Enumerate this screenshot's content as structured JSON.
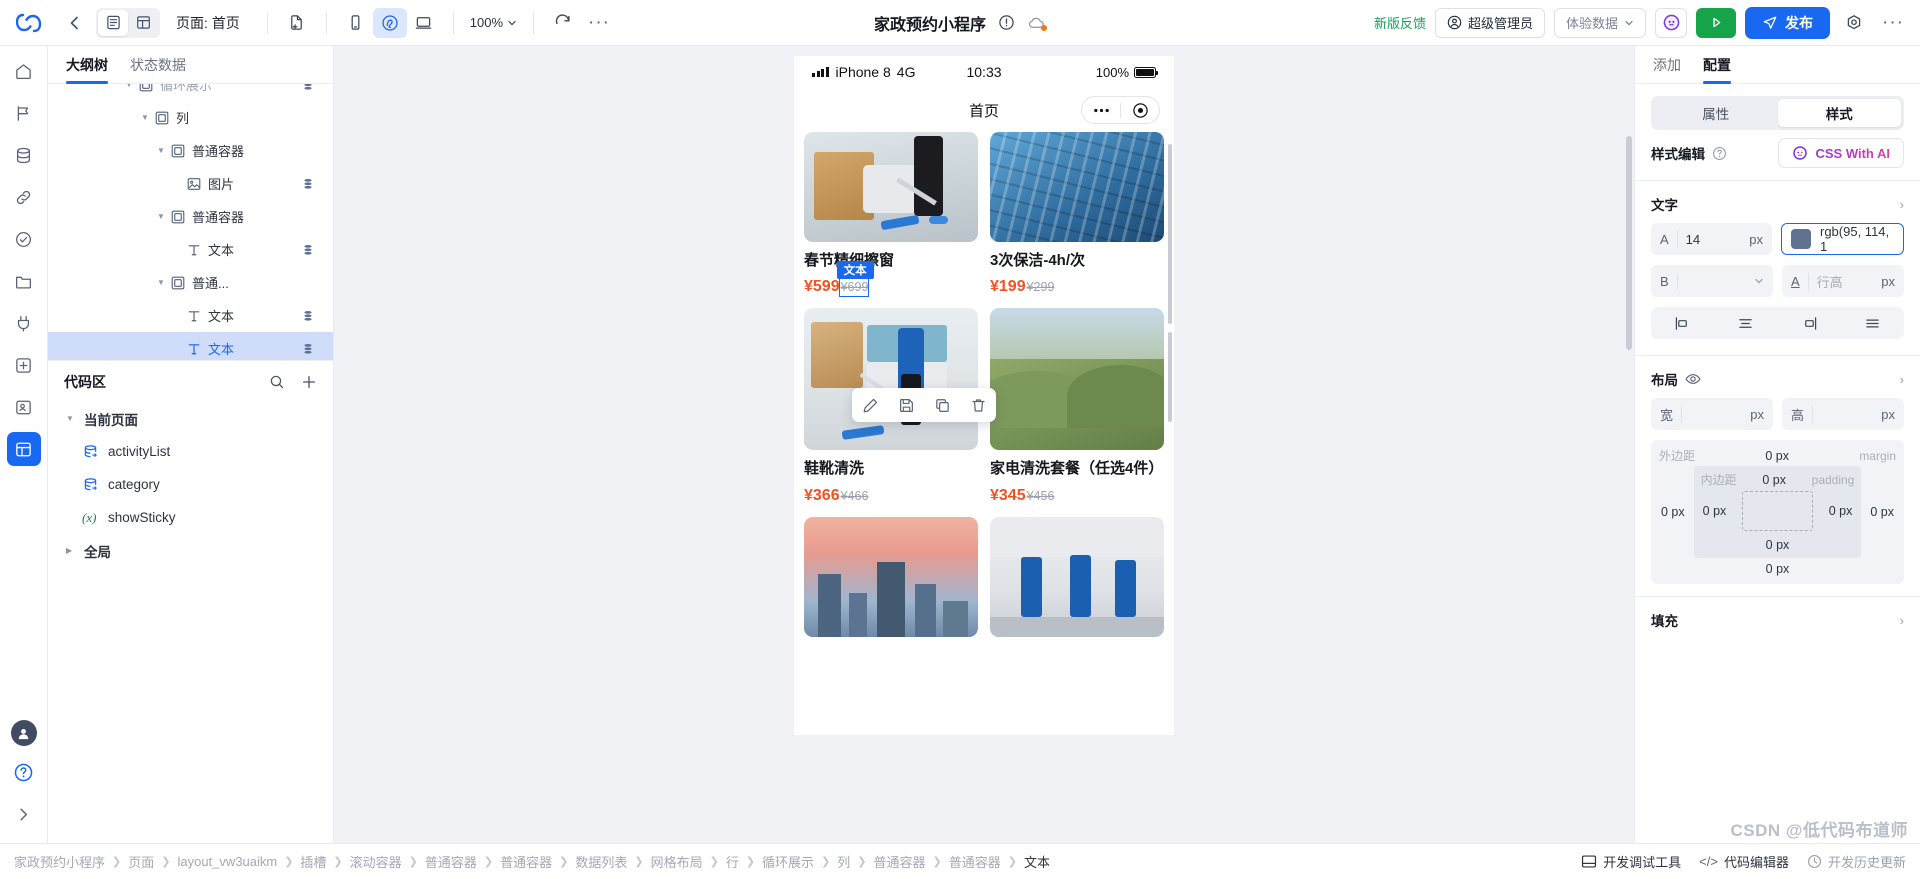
{
  "topbar": {
    "back_icon": "arrow-left-icon",
    "view_modes": [
      {
        "name": "outline-view",
        "icon": "list-view-icon",
        "active": true
      },
      {
        "name": "grid-view",
        "icon": "grid-view-icon",
        "active": false
      }
    ],
    "page_selector_label": "页面: 首页",
    "device_icons": [
      {
        "name": "new-page-icon",
        "active": false
      },
      {
        "name": "mobile-preview-icon",
        "active": false
      },
      {
        "name": "miniprogram-preview-icon",
        "active": true
      },
      {
        "name": "desktop-preview-icon",
        "active": false
      }
    ],
    "zoom_level": "100%",
    "refresh_icon": "refresh-icon",
    "more_icon": "more-horizontal-icon",
    "title": "家政预约小程序",
    "title_icons": [
      "info-circle-icon",
      "cloud-dot-icon"
    ],
    "feedback_label": "新版反馈",
    "role_label": "超级管理员",
    "data_env_label": "体验数据",
    "ai_icon": "ai-assistant-icon",
    "preview_icon": "play-icon",
    "publish_label": "发布",
    "settings_icon": "gear-icon",
    "overflow_icon": "more-horizontal-icon"
  },
  "rail": {
    "items": [
      {
        "name": "home-icon",
        "selected": false
      },
      {
        "name": "flag-icon",
        "selected": false
      },
      {
        "name": "database-icon",
        "selected": false
      },
      {
        "name": "link-icon",
        "selected": false
      },
      {
        "name": "shield-icon",
        "selected": false
      },
      {
        "name": "folder-icon",
        "selected": false
      },
      {
        "name": "plug-icon",
        "selected": false
      },
      {
        "name": "plus-box-icon",
        "selected": false
      },
      {
        "name": "contacts-icon",
        "selected": false
      },
      {
        "name": "layout-icon",
        "selected": true
      }
    ],
    "avatar": "user-avatar",
    "help_icon": "help-circle-icon",
    "expand_icon": "chevron-right-icon"
  },
  "left_panel": {
    "tabs": [
      {
        "label": "大纲树",
        "active": true
      },
      {
        "label": "状态数据",
        "active": false
      }
    ],
    "tree": [
      {
        "label": "循环展示",
        "indent": 4,
        "caret": "down",
        "icon": "container-icon",
        "db": true,
        "clipped": true,
        "selected": false
      },
      {
        "label": "列",
        "indent": 5,
        "caret": "down",
        "icon": "container-icon",
        "db": false,
        "selected": false
      },
      {
        "label": "普通容器",
        "indent": 6,
        "caret": "down",
        "icon": "container-icon",
        "db": false,
        "selected": false
      },
      {
        "label": "图片",
        "indent": 7,
        "caret": "none",
        "icon": "image-icon",
        "db": true,
        "selected": false
      },
      {
        "label": "普通容器",
        "indent": 6,
        "caret": "down",
        "icon": "container-icon",
        "db": false,
        "selected": false
      },
      {
        "label": "文本",
        "indent": 7,
        "caret": "none",
        "icon": "text-icon",
        "db": true,
        "selected": false
      },
      {
        "label": "普通...",
        "indent": 6,
        "caret": "down",
        "icon": "container-icon",
        "db": false,
        "selected": false
      },
      {
        "label": "文本",
        "indent": 7,
        "caret": "none",
        "icon": "text-icon",
        "db": true,
        "selected": false
      },
      {
        "label": "文本",
        "indent": 7,
        "caret": "none",
        "icon": "text-icon",
        "db": true,
        "selected": true
      }
    ],
    "code_area": {
      "title": "代码区",
      "search_icon": "search-icon",
      "add_icon": "plus-icon",
      "groups": [
        {
          "label": "当前页面",
          "caret": "down"
        },
        {
          "label": "全局",
          "caret": "right"
        }
      ],
      "items": [
        {
          "label": "activityList",
          "icon": "dataset-icon"
        },
        {
          "label": "category",
          "icon": "dataset-icon"
        },
        {
          "label": "showSticky",
          "icon": "variable-icon"
        }
      ]
    }
  },
  "canvas": {
    "device": {
      "carrier": "iPhone 8",
      "network": "4G",
      "time": "10:33",
      "battery_label": "100%"
    },
    "nav_title": "首页",
    "capsule": {
      "more_icon": "more-dots-icon",
      "target_icon": "target-icon"
    },
    "cards": [
      {
        "title": "春节精细擦窗",
        "price": "¥599",
        "old_price": "¥699",
        "image": "cleaning-floor-photo",
        "selected_price": true
      },
      {
        "title": "3次保洁-4h/次",
        "price": "¥199",
        "old_price": "¥299",
        "image": "glass-building-photo",
        "selected_price": false
      },
      {
        "title": "鞋靴清洗",
        "price": "¥366",
        "old_price": "¥466",
        "image": "mopping-living-room-photo",
        "selected_price": false
      },
      {
        "title": "家电清洗套餐（任选4件）",
        "price": "¥345",
        "old_price": "¥456",
        "image": "green-hills-photo",
        "selected_price": false
      },
      {
        "title": "",
        "price": "",
        "old_price": "",
        "image": "city-sunset-photo",
        "selected_price": false
      },
      {
        "title": "",
        "price": "",
        "old_price": "",
        "image": "office-cleaning-photo",
        "selected_price": false
      }
    ],
    "selection_tag": "文本",
    "mini_toolbar": [
      {
        "name": "edit-icon"
      },
      {
        "name": "save-icon"
      },
      {
        "name": "copy-icon"
      },
      {
        "name": "delete-icon"
      }
    ]
  },
  "right_panel": {
    "tabs": [
      {
        "label": "添加",
        "active": false
      },
      {
        "label": "配置",
        "active": true
      }
    ],
    "mode_seg": [
      {
        "label": "属性",
        "active": false
      },
      {
        "label": "样式",
        "active": true
      }
    ],
    "style_edit": {
      "label": "样式编辑",
      "help_icon": "question-circle-icon",
      "ai_button": "CSS With AI",
      "ai_icon": "ai-sparkle-icon"
    },
    "text_section": {
      "title": "文字",
      "chevron": "chevron-right-icon",
      "font_size_prefix": "A",
      "font_size_value": "14",
      "font_size_unit": "px",
      "color_value": "rgb(95, 114, 1",
      "color_swatch": "#5f7290",
      "weight_prefix": "B",
      "weight_value": "",
      "lineheight_prefix": "A",
      "lineheight_placeholder": "行高",
      "lineheight_unit": "px",
      "align_icons": [
        "align-left-icon",
        "align-center-icon",
        "align-right-icon",
        "align-justify-icon"
      ]
    },
    "layout_section": {
      "title": "布局",
      "eye_icon": "eye-icon",
      "chevron": "chevron-right-icon",
      "width_label": "宽",
      "width_value": "",
      "width_unit": "px",
      "height_label": "高",
      "height_value": "",
      "height_unit": "px",
      "margin_label": "外边距",
      "margin_en": "margin",
      "padding_label": "内边距",
      "padding_en": "padding",
      "margin_top": "0 px",
      "margin_right": "0 px",
      "margin_bottom": "0 px",
      "margin_left": "0 px",
      "padding_top": "0 px",
      "padding_right": "0 px",
      "padding_bottom": "0 px",
      "padding_left": "0 px"
    },
    "fill_section": {
      "title": "填充",
      "chevron": "chevron-right-icon"
    }
  },
  "bottom": {
    "breadcrumb": [
      "家政预约小程序",
      "页面",
      "layout_vw3uaikm",
      "插槽",
      "滚动容器",
      "普通容器",
      "普通容器",
      "数据列表",
      "网格布局",
      "行",
      "循环展示",
      "列",
      "普通容器",
      "普通容器",
      "文本"
    ],
    "dev_tools_label": "开发调试工具",
    "dev_tools_icon": "panel-icon",
    "code_editor_label": "代码编辑器",
    "code_editor_icon": "code-icon",
    "history_label": "开发历史更新",
    "history_icon": "clock-icon"
  },
  "watermark": "CSDN @低代码布道师"
}
